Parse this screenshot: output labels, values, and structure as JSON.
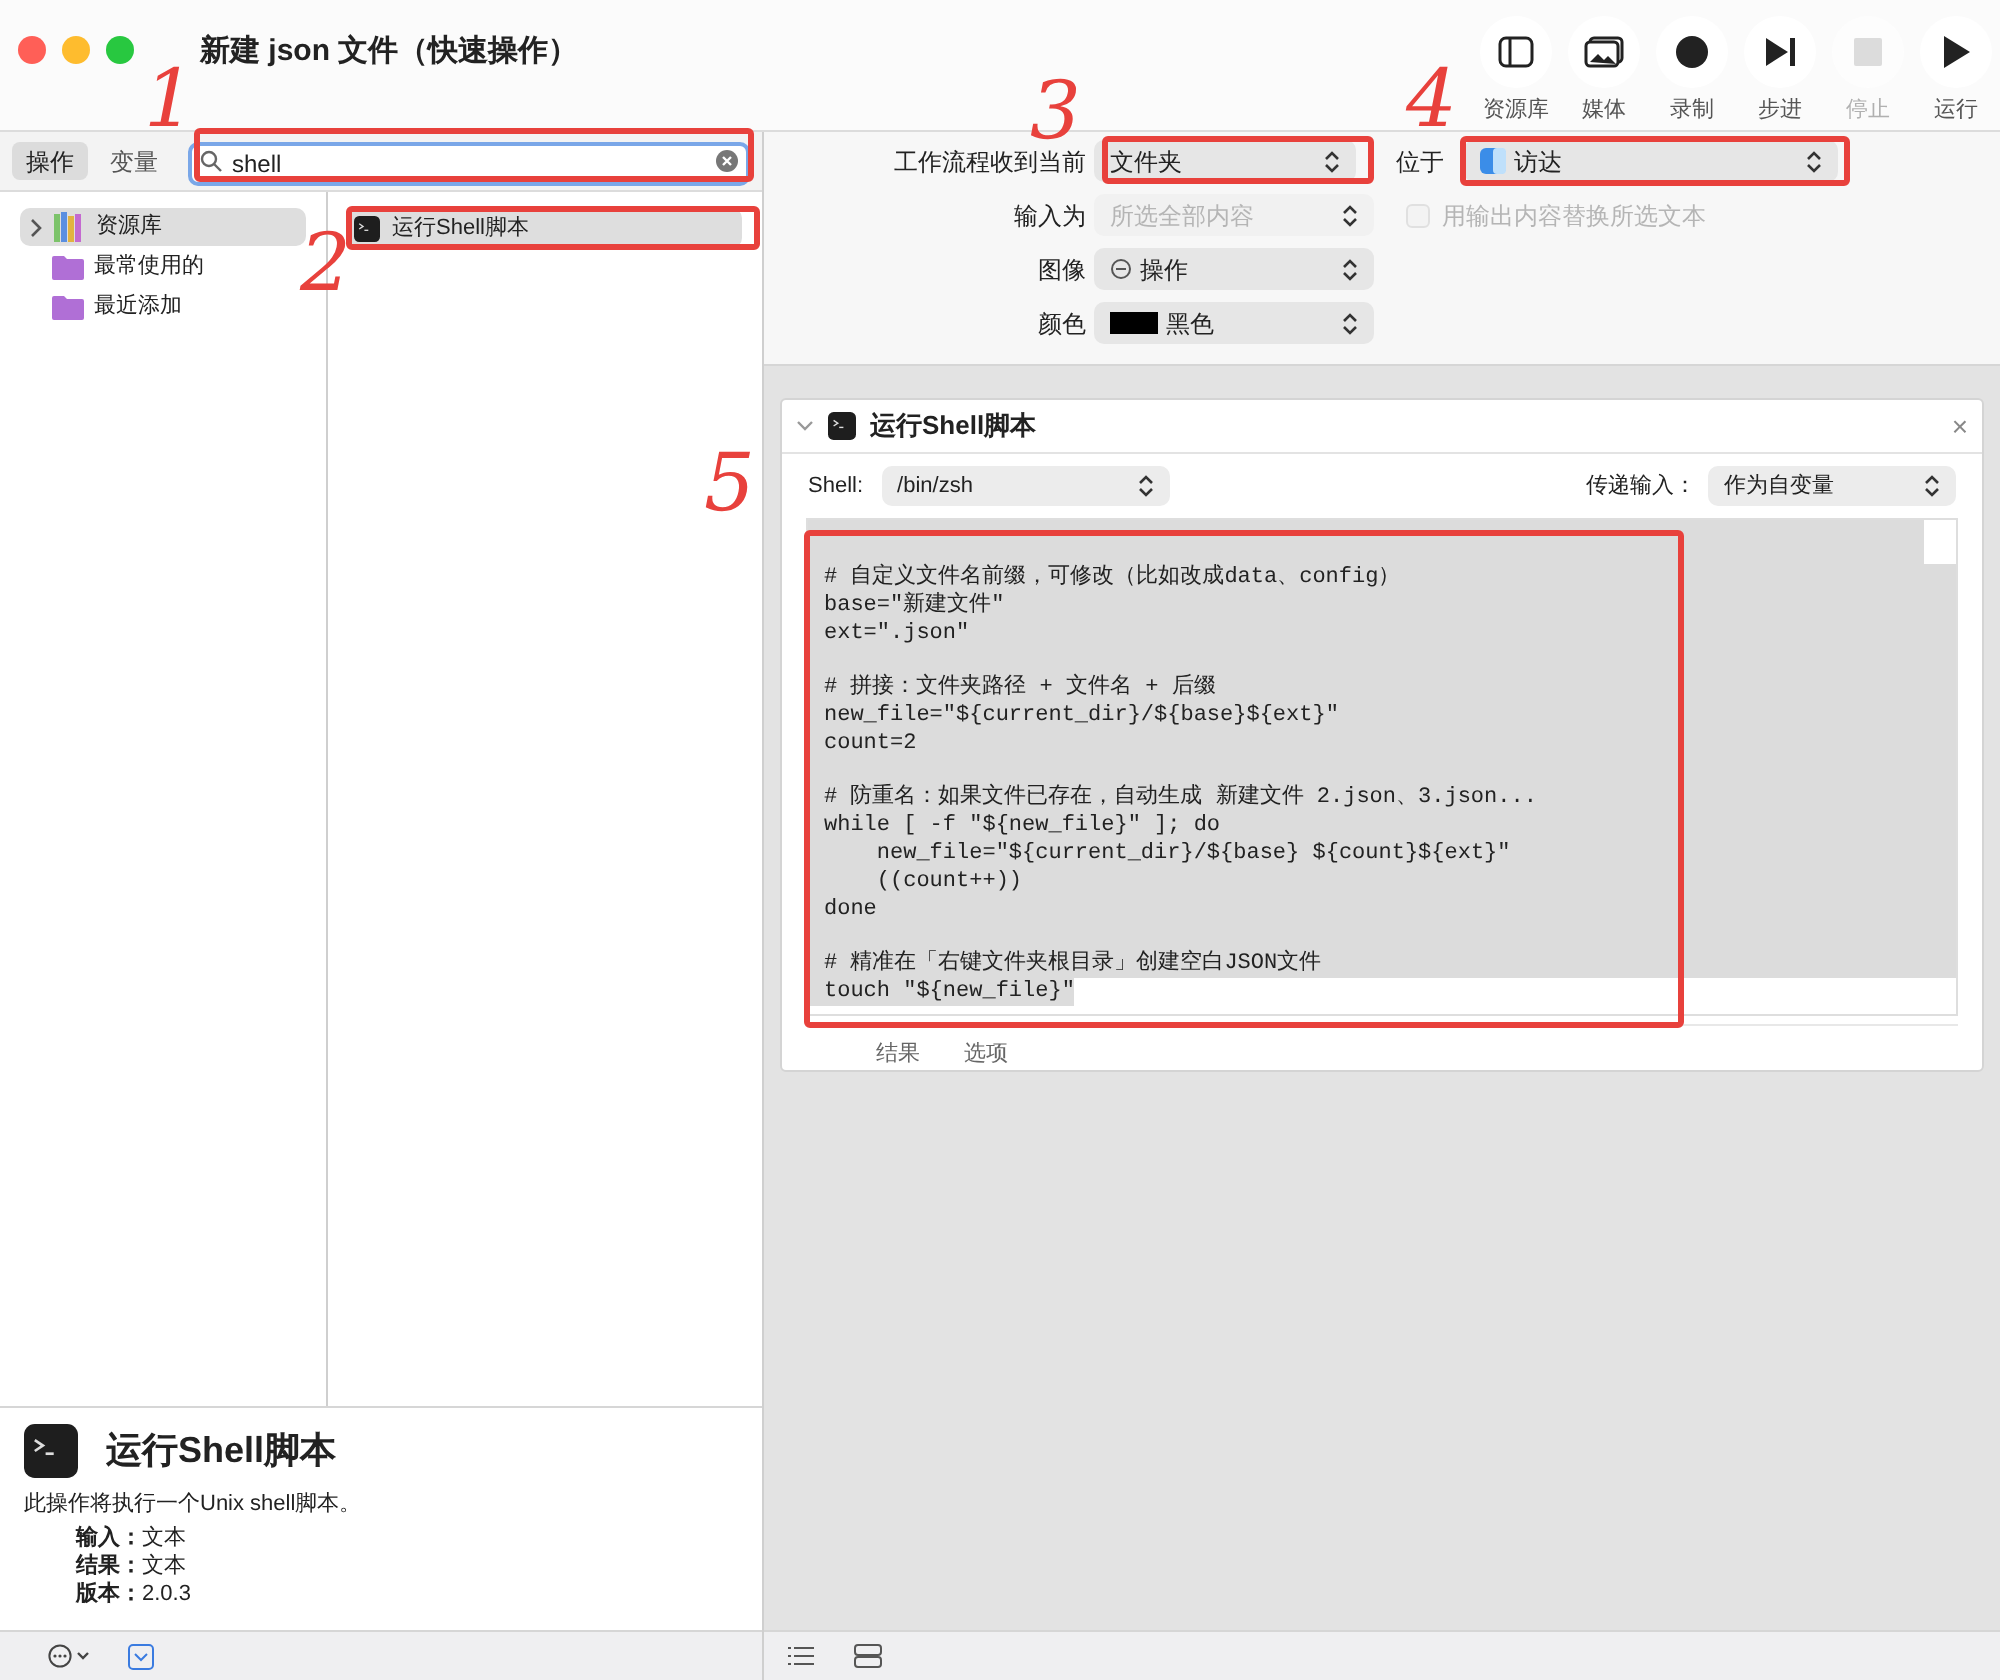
{
  "window": {
    "title": "新建 json 文件（快速操作）"
  },
  "toolbar": [
    {
      "label": "资源库",
      "kind": "library",
      "disabled": false
    },
    {
      "label": "媒体",
      "kind": "media",
      "disabled": false
    },
    {
      "label": "录制",
      "kind": "record",
      "disabled": false
    },
    {
      "label": "步进",
      "kind": "step",
      "disabled": false
    },
    {
      "label": "停止",
      "kind": "stop",
      "disabled": true
    },
    {
      "label": "运行",
      "kind": "run",
      "disabled": false
    }
  ],
  "library_tabs": [
    {
      "label": "操作",
      "selected": true
    },
    {
      "label": "变量",
      "selected": false
    }
  ],
  "search": {
    "value": "shell"
  },
  "library": [
    {
      "label": "资源库",
      "kind": "library",
      "selected": true
    },
    {
      "label": "最常使用的",
      "kind": "folder",
      "selected": false
    },
    {
      "label": "最近添加",
      "kind": "folder",
      "selected": false
    }
  ],
  "actions": [
    {
      "label": "运行Shell脚本",
      "selected": true
    }
  ],
  "workflow": {
    "receives": {
      "label": "工作流程收到当前",
      "value": "文件夹"
    },
    "location": {
      "label": "位于",
      "value": "访达"
    },
    "input": {
      "label": "输入为",
      "value": "所选全部内容",
      "disabled": true
    },
    "replace": {
      "label": "用输出内容替换所选文本",
      "checked": false,
      "disabled": true
    },
    "image": {
      "label": "图像",
      "value": "操作"
    },
    "color": {
      "label": "颜色",
      "value": "黑色"
    }
  },
  "action_card": {
    "title": "运行Shell脚本",
    "close": "×",
    "shell_label": "Shell:",
    "shell": "/bin/zsh",
    "pass_label": "传递输入：",
    "pass": "作为自变量",
    "code": [
      [
        "# 自定义文件名前缀，可修改（比如改成data、config）",
        "base=\"新建文件\"",
        "ext=\".json\""
      ],
      [
        "# 拼接：文件夹路径 + 文件名 + 后缀",
        "new_file=\"${current_dir}/${base}${ext}\"",
        "count=2"
      ],
      [
        "# 防重名：如果文件已存在，自动生成 新建文件 2.json、3.json...",
        "while [ -f \"${new_file}\" ]; do",
        "    new_file=\"${current_dir}/${base} ${count}${ext}\"",
        "    ((count++))",
        "done"
      ],
      [
        "# 精准在「右键文件夹根目录」创建空白JSON文件",
        "touch \"${new_file}\""
      ]
    ],
    "tabs": [
      {
        "label": "结果",
        "selected": false
      },
      {
        "label": "选项",
        "selected": false
      }
    ]
  },
  "description": {
    "title": "运行Shell脚本",
    "text": "此操作将执行一个Unix shell脚本。",
    "details": [
      {
        "label": "输入：",
        "value": "文本"
      },
      {
        "label": "结果：",
        "value": "文本"
      },
      {
        "label": "版本：",
        "value": "2.0.3"
      }
    ]
  },
  "annotations": [
    {
      "label": "1"
    },
    {
      "label": "2"
    },
    {
      "label": "3"
    },
    {
      "label": "4"
    },
    {
      "label": "5"
    }
  ]
}
